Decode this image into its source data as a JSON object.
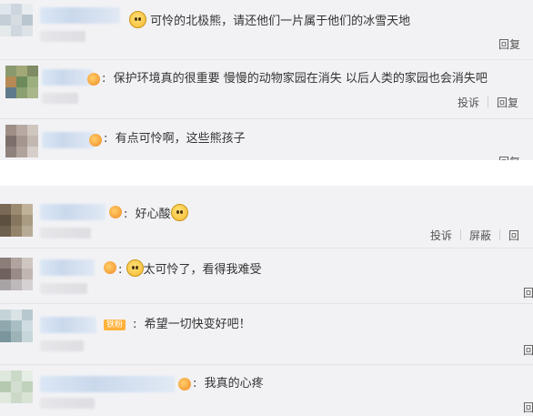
{
  "top_comments": [
    {
      "text": "可怜的北极熊，请还他们一片属于他们的冰雪天地",
      "actions": [
        "回复"
      ]
    },
    {
      "text": "保护环境真的很重要 慢慢的动物家园在消失 以后人类的家园也会消失吧",
      "actions": [
        "投诉",
        "回复"
      ]
    },
    {
      "text": "有点可怜啊，这些熊孩子",
      "actions": [
        "回复"
      ]
    }
  ],
  "bottom_comments": [
    {
      "text": "好心酸",
      "actions": [
        "投诉",
        "屏蔽",
        "回"
      ]
    },
    {
      "text": "太可怜了，看得我难受",
      "actions": [
        "回"
      ]
    },
    {
      "text": "希望一切快变好吧！",
      "tag": "铁粉",
      "actions": [
        "回"
      ]
    },
    {
      "text": "我真的心疼",
      "actions": [
        "回"
      ]
    }
  ],
  "emoji_icons": [
    "crying-face-icon",
    "sad-face-icon",
    "worried-face-icon"
  ],
  "colors": {
    "panel_bg": "#f2f2f5",
    "text": "#333333",
    "action": "#555555",
    "tag_bg": "#ffb13b"
  }
}
